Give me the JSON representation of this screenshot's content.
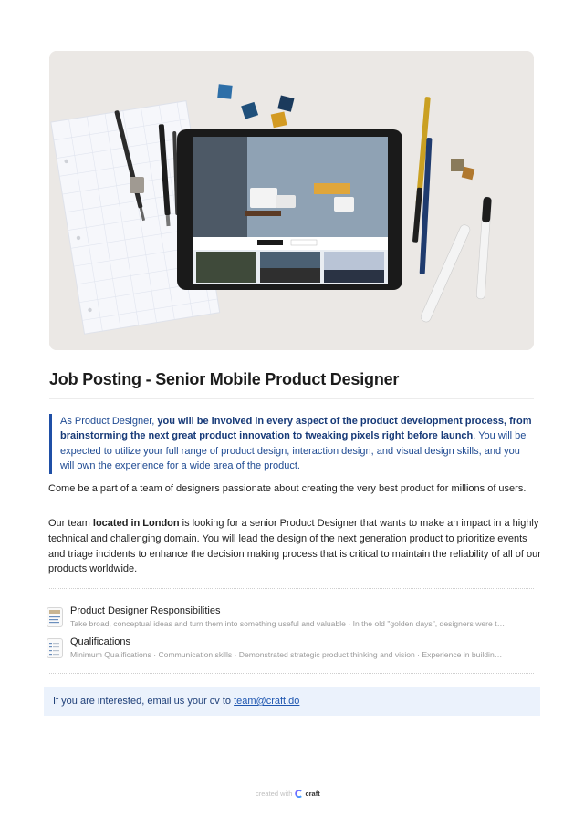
{
  "hero": {
    "alt": "tablet and pens on desk"
  },
  "title": "Job Posting - Senior Mobile Product Designer",
  "callout": {
    "intro": "As Product Designer, ",
    "bold": "you will be involved in every aspect of the product development process, from brainstorming the next great product innovation to tweaking pixels right before launch",
    "rest": ". You will be expected to utilize your full range of product design, interaction design, and visual design skills, and you will own the experience for a wide area of the product."
  },
  "para1": "Come be a part of a team of designers passionate about creating the very best product for millions of users.",
  "para2": {
    "pre": "Our team ",
    "bold": "located in London",
    "post": " is looking for a senior Product Designer that wants to make an impact in a highly technical and challenging domain. You will lead the design of the next generation product to prioritize events and triage incidents to enhance the decision making process that is critical to maintain the reliability of all of our products worldwide."
  },
  "cards": [
    {
      "title": "Product Designer Responsibilities",
      "subtitle": "Take broad, conceptual ideas and turn them into something useful and valuable · In the old \"golden days\", designers were t…"
    },
    {
      "title": "Qualifications",
      "subtitle": "Minimum Qualifications · Communication skills · Demonstrated strategic product thinking and vision · Experience in buildin…"
    }
  ],
  "contact": {
    "text": "If you are interested, email us your cv to ",
    "email": "team@craft.do"
  },
  "footer": {
    "created": "created with",
    "brand": "craft"
  }
}
